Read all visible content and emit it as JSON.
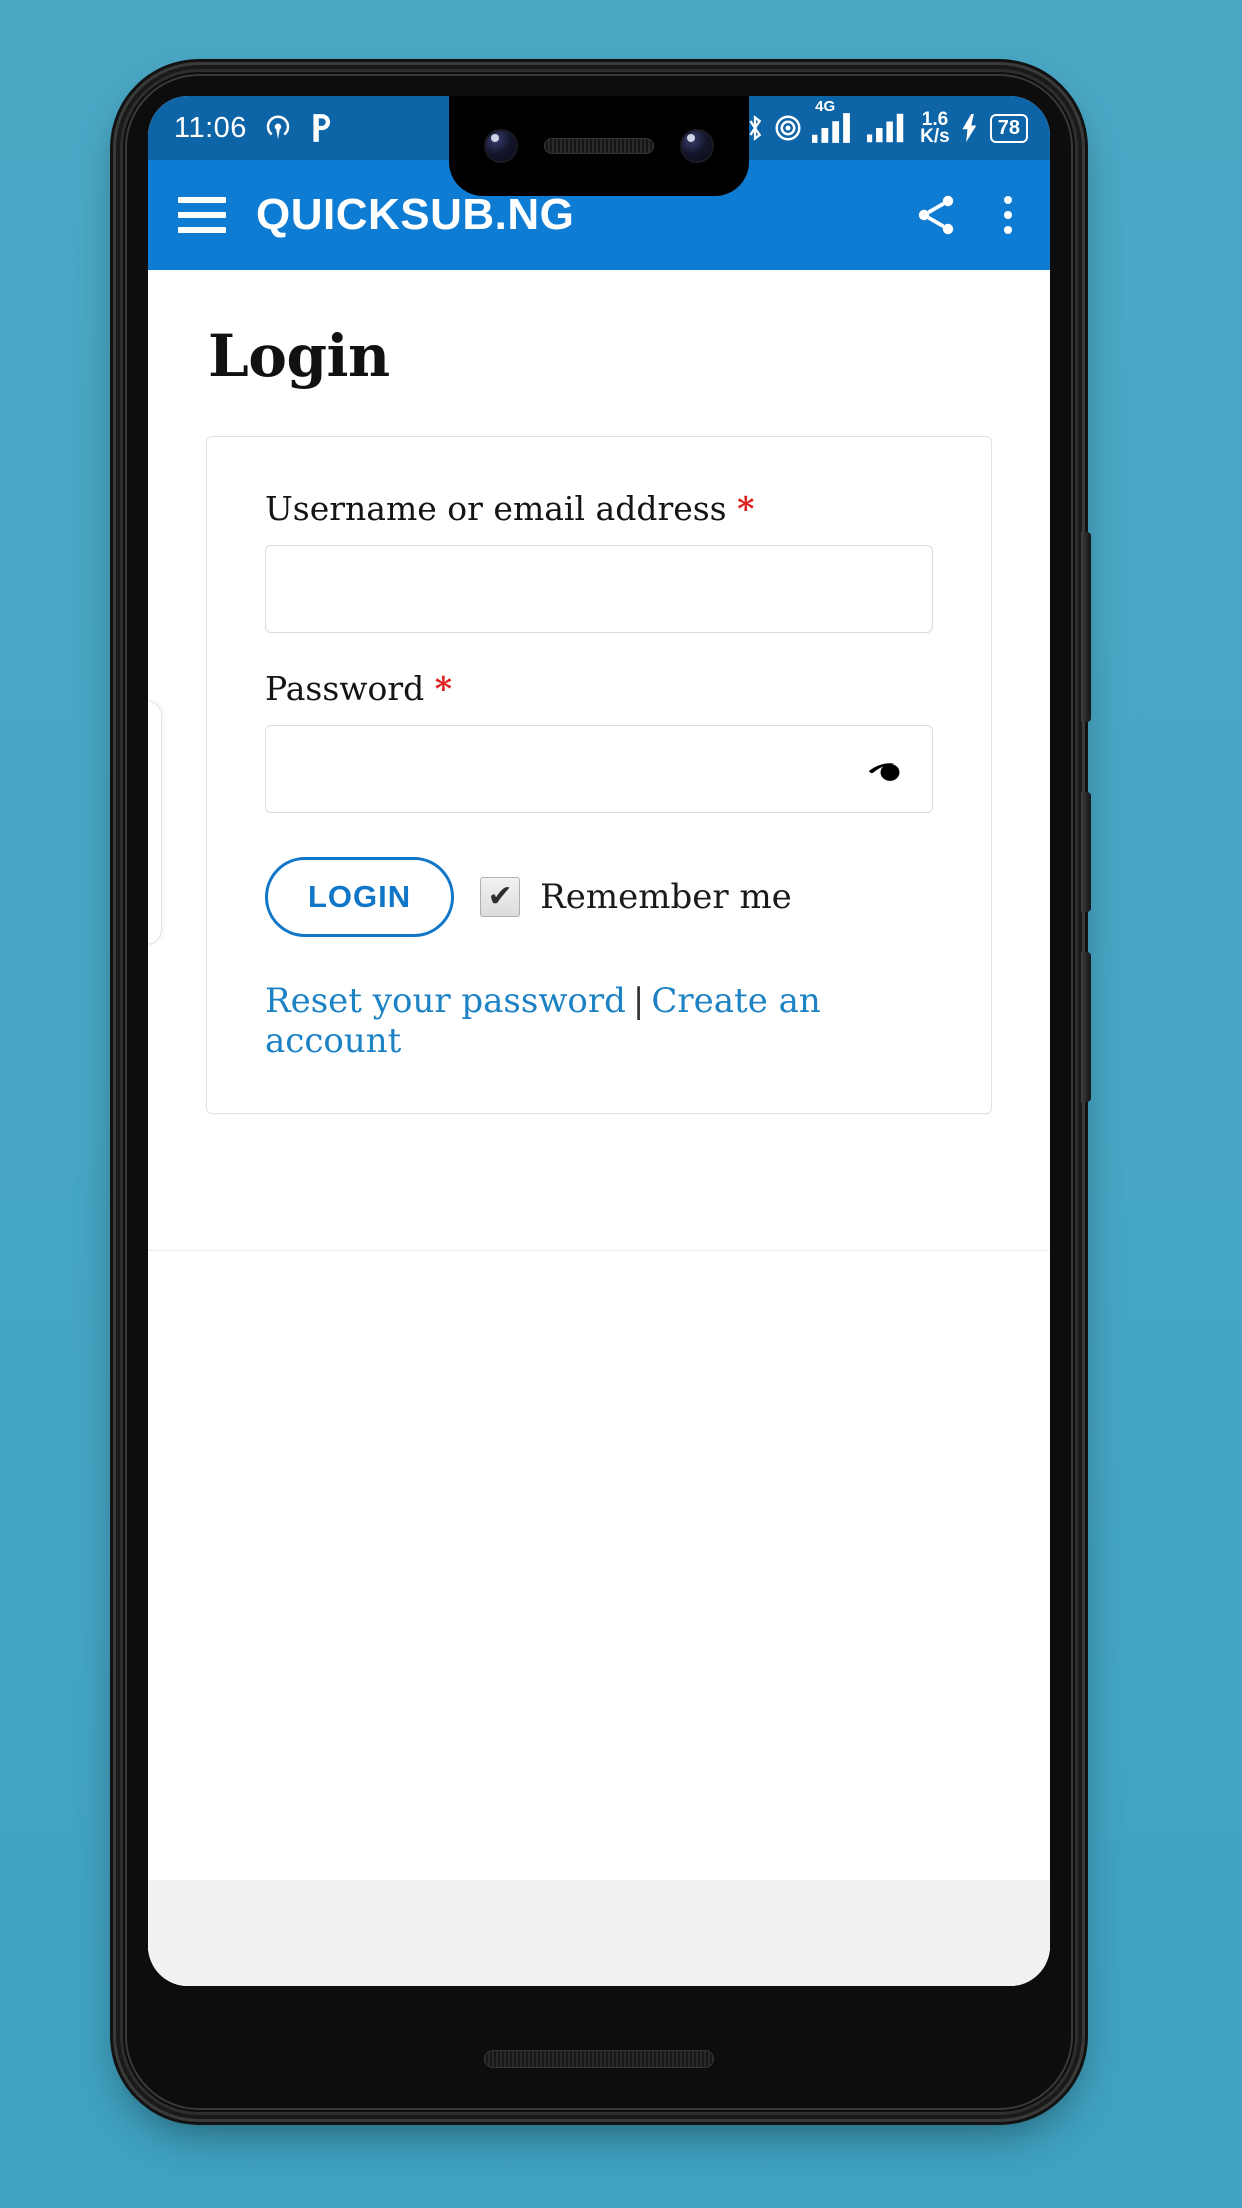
{
  "status_bar": {
    "clock": "11:06",
    "left_icons": [
      "hotspot-icon",
      "p-app-icon"
    ],
    "right_icons": [
      "bluetooth-icon",
      "hotspot-icon",
      "signal-4g-icon",
      "signal-icon",
      "charging-bolt-icon"
    ],
    "network_label": "4G",
    "net_speed_value": "1.6",
    "net_speed_unit": "K/s",
    "battery_level": "78"
  },
  "app_bar": {
    "menu_icon": "hamburger-menu-icon",
    "title": "QUICKSUB.NG",
    "share_icon": "share-icon",
    "overflow_icon": "overflow-menu-icon",
    "background_color": "#0f7cd4"
  },
  "page": {
    "title": "Login"
  },
  "form": {
    "username": {
      "label": "Username or email address",
      "required_marker": "*",
      "value": "",
      "placeholder": ""
    },
    "password": {
      "label": "Password",
      "required_marker": "*",
      "value": "",
      "placeholder": "",
      "toggle_icon": "eye-icon"
    },
    "login_button": "LOGIN",
    "remember_me": {
      "label": "Remember me",
      "checked": true,
      "check_glyph": "✔"
    }
  },
  "links": {
    "reset_password": "Reset your password",
    "separator": "|",
    "create_account": "Create an account",
    "link_color": "#1c82c4"
  },
  "colors": {
    "accent_blue": "#0f7cd4",
    "status_bar_blue": "#0d65a8",
    "required_red": "#e02020",
    "backdrop": "#4aa9c6",
    "footer_gray": "#f1f1f1"
  }
}
